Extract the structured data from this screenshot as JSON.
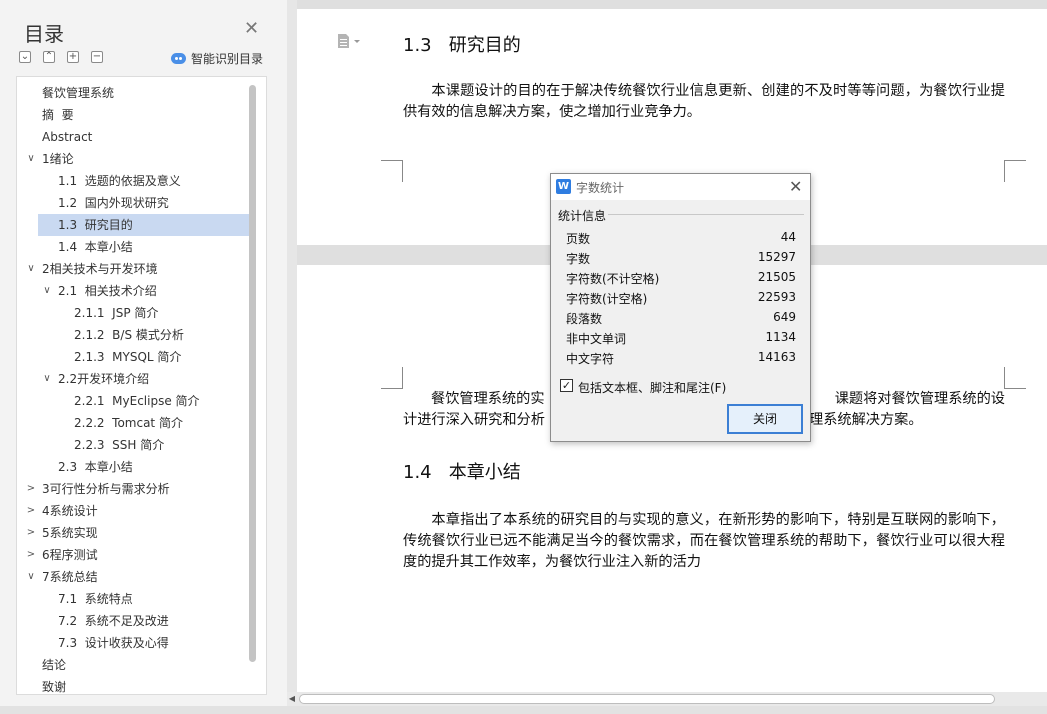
{
  "toc": {
    "title": "目录",
    "smart_label": "智能识别目录",
    "items": [
      {
        "text": "餐饮管理系统",
        "level": 0,
        "arrow": ""
      },
      {
        "text": "摘  要",
        "level": 0,
        "arrow": ""
      },
      {
        "text": "Abstract",
        "level": 0,
        "arrow": ""
      },
      {
        "text": "1绪论",
        "level": 0,
        "arrow": "v"
      },
      {
        "text": "1.1  选题的依据及意义",
        "level": 1,
        "arrow": ""
      },
      {
        "text": "1.2  国内外现状研究",
        "level": 1,
        "arrow": ""
      },
      {
        "text": "1.3  研究目的",
        "level": 1,
        "arrow": "",
        "selected": true
      },
      {
        "text": "1.4  本章小结",
        "level": 1,
        "arrow": ""
      },
      {
        "text": "2相关技术与开发环境",
        "level": 0,
        "arrow": "v"
      },
      {
        "text": "2.1  相关技术介绍",
        "level": 1,
        "arrow": "v"
      },
      {
        "text": "2.1.1  JSP 简介",
        "level": 2,
        "arrow": ""
      },
      {
        "text": "2.1.2  B/S 模式分析",
        "level": 2,
        "arrow": ""
      },
      {
        "text": "2.1.3  MYSQL 简介",
        "level": 2,
        "arrow": ""
      },
      {
        "text": "2.2开发环境介绍",
        "level": 1,
        "arrow": "v"
      },
      {
        "text": "2.2.1  MyEclipse 简介",
        "level": 2,
        "arrow": ""
      },
      {
        "text": "2.2.2  Tomcat 简介",
        "level": 2,
        "arrow": ""
      },
      {
        "text": "2.2.3  SSH 简介",
        "level": 2,
        "arrow": ""
      },
      {
        "text": "2.3  本章小结",
        "level": 1,
        "arrow": ""
      },
      {
        "text": "3可行性分析与需求分析",
        "level": 0,
        "arrow": ">"
      },
      {
        "text": "4系统设计",
        "level": 0,
        "arrow": ">"
      },
      {
        "text": "5系统实现",
        "level": 0,
        "arrow": ">"
      },
      {
        "text": "6程序测试",
        "level": 0,
        "arrow": ">"
      },
      {
        "text": "7系统总结",
        "level": 0,
        "arrow": "v"
      },
      {
        "text": "7.1  系统特点",
        "level": 1,
        "arrow": ""
      },
      {
        "text": "7.2  系统不足及改进",
        "level": 1,
        "arrow": ""
      },
      {
        "text": "7.3  设计收获及心得",
        "level": 1,
        "arrow": ""
      },
      {
        "text": "结论",
        "level": 0,
        "arrow": ""
      },
      {
        "text": "致谢",
        "level": 0,
        "arrow": ""
      }
    ]
  },
  "document": {
    "heading_13": "1.3   研究目的",
    "para_13": "本课题设计的目的在于解决传统餐饮行业信息更新、创建的不及时等等问题，为餐饮行业提供有效的信息解决方案，使之增加行业竞争力。",
    "para_partial_a": "餐饮管理系统的实",
    "para_partial_b": "课题将对餐饮管理系统的设",
    "para_partial_c": "计进行深入研究和分析",
    "para_partial_d": "理系统解决方案。",
    "heading_14": "1.4   本章小结",
    "para_14": "本章指出了本系统的研究目的与实现的意义，在新形势的影响下，特别是互联网的影响下，传统餐饮行业已远不能满足当今的餐饮需求，而在餐饮管理系统的帮助下，餐饮行业可以很大程度的提升其工作效率，为餐饮行业注入新的活力"
  },
  "dialog": {
    "logo": "W",
    "title": "字数统计",
    "section": "统计信息",
    "stats": [
      {
        "label": "页数",
        "value": "44"
      },
      {
        "label": "字数",
        "value": "15297"
      },
      {
        "label": "字符数(不计空格)",
        "value": "21505"
      },
      {
        "label": "字符数(计空格)",
        "value": "22593"
      },
      {
        "label": "段落数",
        "value": "649"
      },
      {
        "label": "非中文单词",
        "value": "1134"
      },
      {
        "label": "中文字符",
        "value": "14163"
      }
    ],
    "checkbox_checked": true,
    "checkbox_label": "包括文本框、脚注和尾注(F)",
    "close_button": "关闭"
  },
  "colors": {
    "selected_bg": "#c9d9f1",
    "accent": "#3c7fd4",
    "wps_blue": "#2f7de1"
  }
}
